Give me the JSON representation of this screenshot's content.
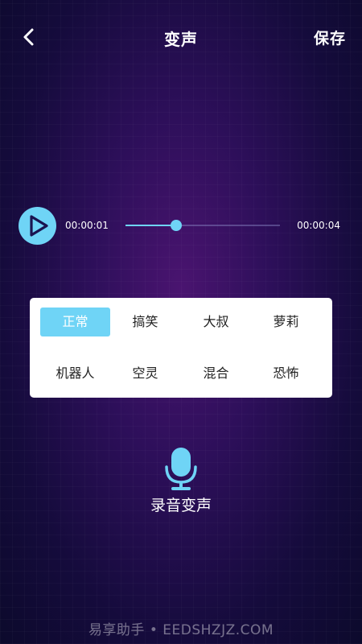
{
  "header": {
    "title": "变声",
    "save_label": "保存",
    "back_icon": "chevron-left-icon"
  },
  "player": {
    "play_icon": "play-icon",
    "current_time": "00:00:01",
    "total_time": "00:00:04",
    "progress": 0.33
  },
  "effects": {
    "items": [
      "正常",
      "搞笑",
      "大叔",
      "萝莉",
      "机器人",
      "空灵",
      "混合",
      "恐怖"
    ],
    "selected": "正常"
  },
  "record": {
    "icon": "microphone-icon",
    "label": "录音变声"
  },
  "watermark": "易享助手 • EEDSHZJZ.COM",
  "colors": {
    "accent": "#6fd4f6",
    "panel_bg": "#ffffff",
    "text_dark": "#222222",
    "background_center": "#4a1470",
    "background_edge": "#0c0a2c"
  }
}
